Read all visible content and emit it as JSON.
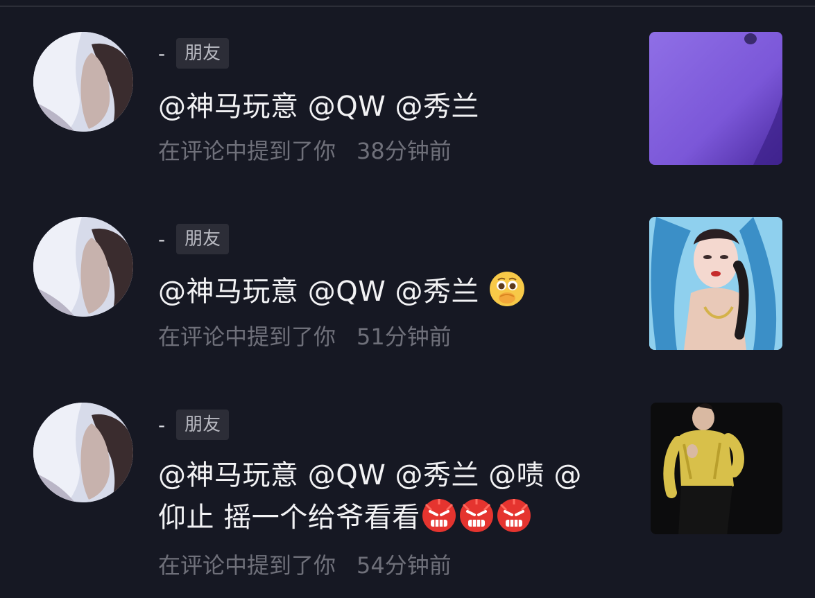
{
  "notifications": [
    {
      "username": "-",
      "tag": "朋友",
      "mentions": "@神马玩意 @QW @秀兰",
      "emoji": [],
      "action": "在评论中提到了你",
      "time": "38分钟前",
      "thumbnail": "purple-video-thumbnail"
    },
    {
      "username": "-",
      "tag": "朋友",
      "mentions": "@神马玩意 @QW @秀兰",
      "emoji": [
        "pleading-face-icon"
      ],
      "action": "在评论中提到了你",
      "time": "51分钟前",
      "thumbnail": "woman-blue-veil-thumbnail"
    },
    {
      "username": "-",
      "tag": "朋友",
      "mentions_line1": "@神马玩意 @QW @秀兰 @啧 @",
      "mentions_line2": "仰止 摇一个给爷看看",
      "emoji": [
        "angry-face-icon",
        "angry-face-icon",
        "angry-face-icon"
      ],
      "action": "在评论中提到了你",
      "time": "54分钟前",
      "thumbnail": "man-gold-jacket-thumbnail"
    }
  ],
  "colors": {
    "background": "#161823",
    "text": "#f2f2f4",
    "meta": "#6f707a",
    "tag_bg": "#2c2d37"
  }
}
